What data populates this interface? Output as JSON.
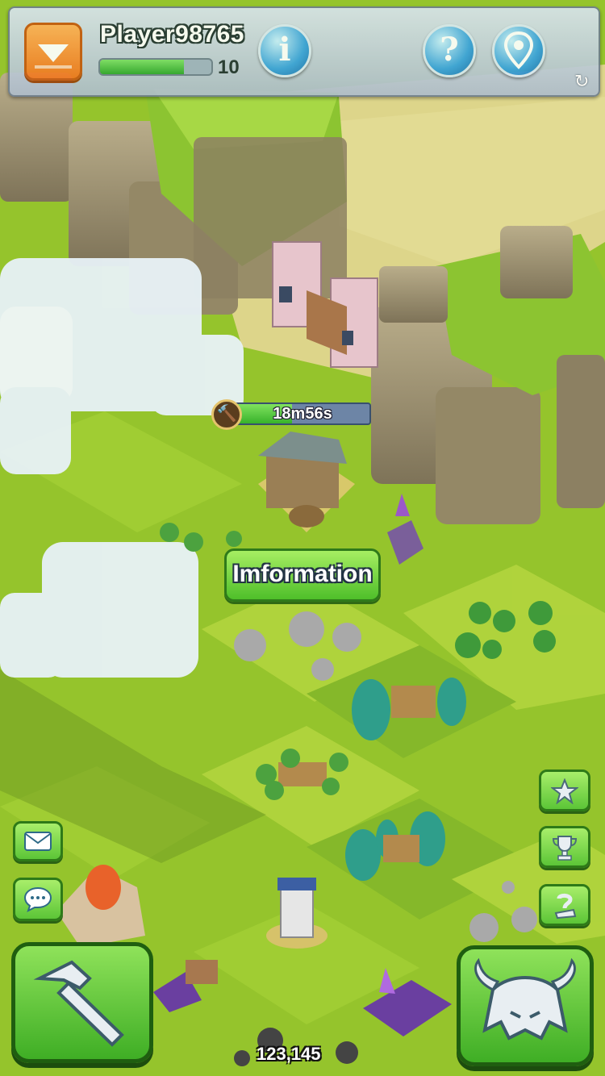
{
  "hud": {
    "player_name": "Player98765",
    "level": "10",
    "xp_progress": 0.75,
    "info_icon": "info-icon",
    "help_icon": "question-icon",
    "location_icon": "map-pin-icon",
    "refresh_icon": "refresh-icon"
  },
  "construction": {
    "timer": "18m56s",
    "progress": 0.42,
    "icon": "hammer-icon"
  },
  "information_button": "Imformation",
  "side_left": {
    "mail_icon": "envelope-icon",
    "chat_icon": "chat-bubble-icon"
  },
  "side_right": {
    "star_icon": "star-icon",
    "trophy_icon": "trophy-icon",
    "quest_icon": "question-scroll-icon"
  },
  "bottom": {
    "build_icon": "hammer-icon",
    "battle_icon": "viking-helmet-icon",
    "resource_count": "123,145"
  },
  "colors": {
    "grass": "#8fbf2a",
    "button_green": "#5cc537",
    "menu_orange": "#f07820",
    "hud_blue": "#3aa3e0"
  }
}
